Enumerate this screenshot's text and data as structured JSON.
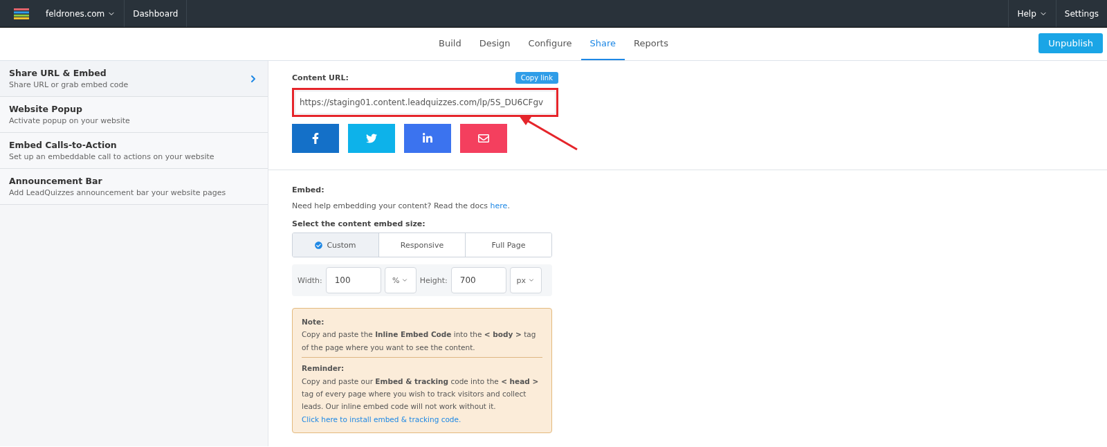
{
  "top_bar": {
    "site": "feldrones.com",
    "dashboard": "Dashboard",
    "help": "Help",
    "settings": "Settings"
  },
  "tabs": [
    {
      "label": "Build",
      "selected": false
    },
    {
      "label": "Design",
      "selected": false
    },
    {
      "label": "Configure",
      "selected": false
    },
    {
      "label": "Share",
      "selected": true
    },
    {
      "label": "Reports",
      "selected": false
    }
  ],
  "unpublish_button": "Unpublish",
  "sidebar": {
    "items": [
      {
        "title": "Share URL & Embed",
        "subtitle": "Share URL or grab embed code",
        "selected": true
      },
      {
        "title": "Website Popup",
        "subtitle": "Activate popup on your website",
        "selected": false
      },
      {
        "title": "Embed Calls-to-Action",
        "subtitle": "Set up an embeddable call to actions on your website",
        "selected": false
      },
      {
        "title": "Announcement Bar",
        "subtitle": "Add LeadQuizzes announcement bar your website pages",
        "selected": false
      }
    ]
  },
  "content_url": {
    "label": "Content URL:",
    "copy_button": "Copy link",
    "value": "https://staging01.content.leadquizzes.com/lp/5S_DU6CFgv"
  },
  "share_buttons": [
    {
      "kind": "facebook",
      "color": "#1470c8"
    },
    {
      "kind": "twitter",
      "color": "#0db2ea"
    },
    {
      "kind": "linkedin",
      "color": "#3b73ef"
    },
    {
      "kind": "email",
      "color": "#f43f5e"
    }
  ],
  "embed": {
    "label": "Embed:",
    "help_text": "Need help embedding your content? Read the docs",
    "help_link": "here",
    "help_end": ".",
    "size_label": "Select the content embed size:",
    "size_options": [
      {
        "label": "Custom",
        "selected": true
      },
      {
        "label": "Responsive",
        "selected": false
      },
      {
        "label": "Full Page",
        "selected": false
      }
    ],
    "width_label": "Width:",
    "width_value": "100",
    "width_unit": "%",
    "height_label": "Height:",
    "height_value": "700",
    "height_unit": "px"
  },
  "note": {
    "title": "Note:",
    "text": "Copy and paste the **Inline Embed Code** into the **< body >** tag of the page where you want to see the content.",
    "reminder_title": "Reminder:",
    "reminder_text": "Copy and paste our **Embed & tracking** code into the **< head >** tag of every page where you wish to track visitors and collect leads. Our inline embed code will not work without it.",
    "reminder_link": "Click here to install embed & tracking code."
  }
}
